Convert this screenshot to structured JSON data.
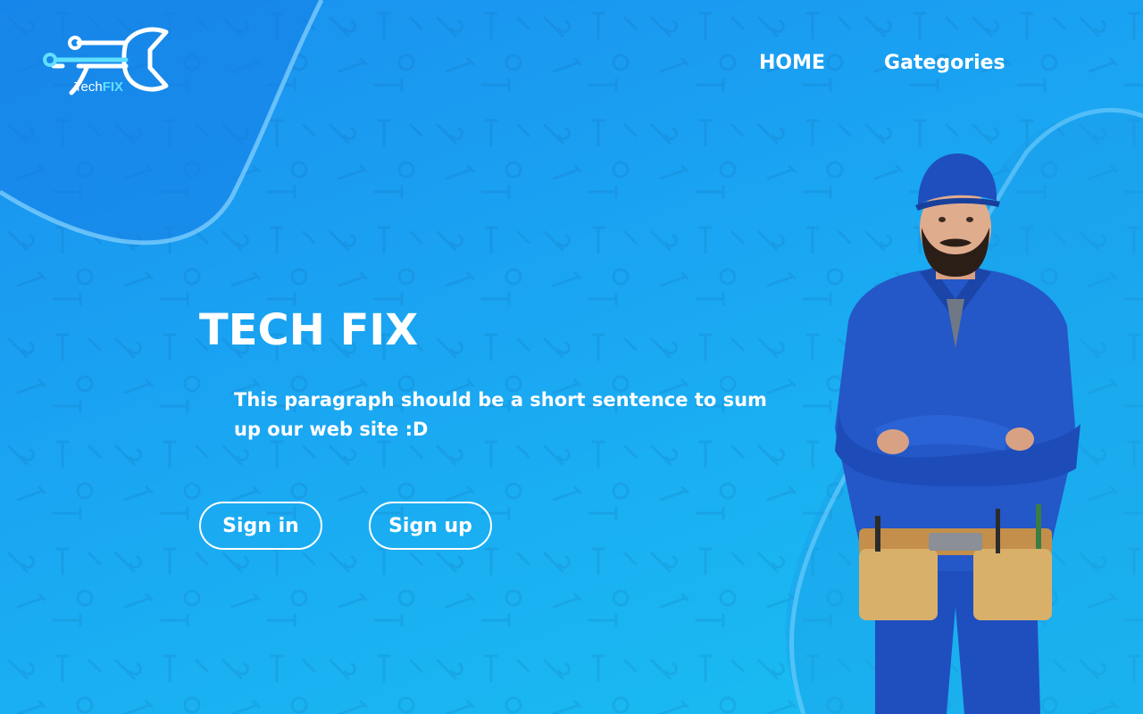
{
  "logo": {
    "text_prefix": "Tech",
    "text_suffix": "FIX"
  },
  "nav": {
    "items": [
      {
        "label": "HOME"
      },
      {
        "label": "Gategories"
      }
    ]
  },
  "hero": {
    "title": "TECH FIX",
    "paragraph": "This paragraph should be a short sentence to sum up our web site :D",
    "buttons": {
      "sign_in": "Sign in",
      "sign_up": "Sign up"
    }
  },
  "colors": {
    "background_start": "#1a8ff0",
    "background_end": "#19c0f2",
    "text": "#ffffff",
    "logo_accent": "#5fe0ff",
    "uniform": "#1f4fbf",
    "tool_belt": "#d9b06a"
  },
  "icons": [
    "wrench-circuit-logo",
    "tool-pattern-background"
  ]
}
